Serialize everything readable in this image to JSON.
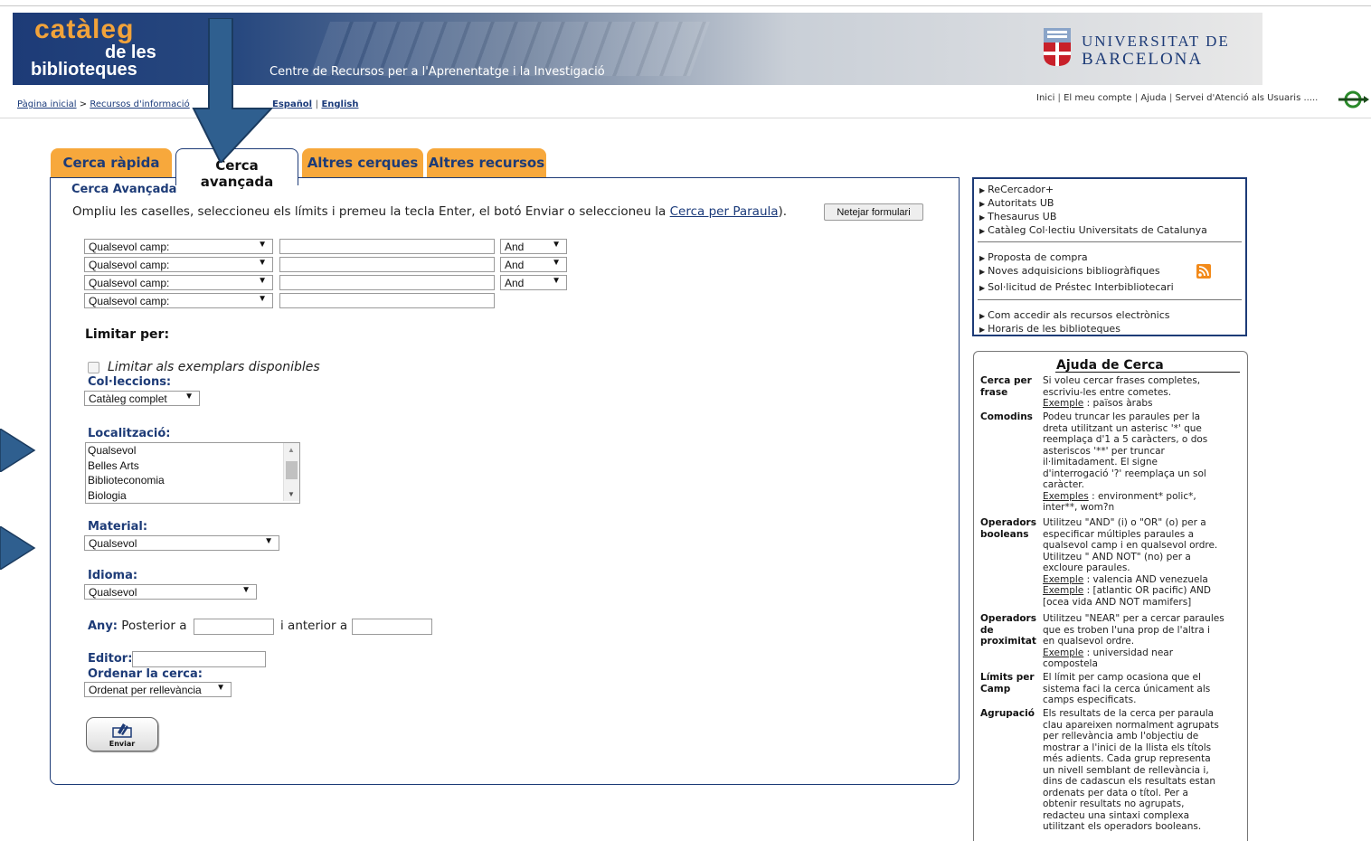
{
  "header": {
    "logo_line1": "catàleg",
    "logo_line2": "de les",
    "logo_line3": "biblioteques",
    "center_title": "Centre de Recursos per a l'Aprenentatge i la Investigació",
    "university_line1": "UNIVERSITAT DE",
    "university_line2": "BARCELONA"
  },
  "breadcrumb": {
    "home": "Pàgina inicial",
    "sep": ">",
    "section": "Recursos d'informació"
  },
  "languages": {
    "es": "Español",
    "sep": "|",
    "en": "English"
  },
  "toplinks": {
    "inici": "Inici",
    "account": "El meu compte",
    "help": "Ajuda",
    "service": "Servei d'Atenció als Usuaris",
    "sep": "|",
    "dots": "....."
  },
  "tabs": {
    "quick": "Cerca ràpida",
    "advanced_l1": "Cerca",
    "advanced_l2": "avançada",
    "other": "Altres cerques",
    "resources": "Altres recursos"
  },
  "form": {
    "title": "Cerca Avançada",
    "instructions_pre": "Ompliu les caselles, seleccioneu els límits i premeu la tecla Enter, el botó Enviar o seleccioneu la ",
    "instructions_link": "Cerca per Paraula",
    "instructions_post": ").",
    "reset_label": "Netejar formulari",
    "field_select": "Qualsevol camp:",
    "bool_select": "And",
    "limit_heading": "Limitar per:",
    "available_label": "Limitar als exemplars disponibles",
    "collections_label": "Col·leccions:",
    "collections_value": "Catàleg complet",
    "location_label": "Localització:",
    "location_options": [
      "Qualsevol",
      "Belles Arts",
      "Biblioteconomia",
      "Biologia"
    ],
    "material_label": "Material:",
    "material_value": "Qualsevol",
    "language_label": "Idioma:",
    "language_value": "Qualsevol",
    "year_label": "Any:",
    "year_after": "Posterior a",
    "year_before": "i anterior a",
    "publisher_label": "Editor:",
    "sort_label": "Ordenar la cerca:",
    "sort_value": "Ordenat per rellevància",
    "submit_label": "Enviar"
  },
  "side_links": {
    "group1": [
      "ReCercador+",
      "Autoritats UB",
      "Thesaurus UB",
      "Catàleg Col·lectiu Universitats de Catalunya"
    ],
    "group2": [
      "Proposta de compra",
      "Noves adquisicions bibliogràfiques",
      "Sol·licitud de Préstec Interbibliotecari"
    ],
    "group3": [
      "Com accedir als recursos electrònics",
      "Horaris de les biblioteques"
    ]
  },
  "help": {
    "title": "Ajuda de Cerca",
    "phrase_term_1": "Cerca per",
    "phrase_term_2": "frase",
    "phrase_desc": [
      "Si voleu cercar frases completes,",
      "escriviu-les entre cometes."
    ],
    "phrase_ex_label": "Exemple",
    "phrase_ex": " : països àrabs",
    "wild_term": "Comodins",
    "wild_desc": [
      "Podeu truncar les paraules per la",
      "dreta utilitzant un asterisc '*' que",
      "reemplaça d'1 a 5 caràcters, o dos",
      "asteriscos '**' per truncar",
      "il·limitadament. El signe",
      "d'interrogació '?' reemplaça un sol",
      "caràcter."
    ],
    "wild_ex_label": "Exemples",
    "wild_ex": " : environment* polic*,",
    "wild_ex2": "inter**, wom?n",
    "bool_term_1": "Operadors",
    "bool_term_2": "booleans",
    "bool_desc": [
      "Utilitzeu \"AND\" (i) o \"OR\" (o) per a",
      "especificar múltiples paraules a",
      "qualsevol camp i en qualsevol ordre.",
      "Utilitzeu \" AND NOT\" (no) per a",
      "excloure paraules."
    ],
    "bool_ex_label": "Exemple",
    "bool_ex1": " : valencia AND venezuela",
    "bool_ex2": " : [atlantic OR pacific) AND",
    "bool_ex3": "[ocea vida AND NOT mamifers]",
    "prox_term_1": "Operadors",
    "prox_term_2": "de",
    "prox_term_3": "proximitat",
    "prox_desc": [
      "Utilitzeu \"NEAR\" per a cercar paraules",
      "que es troben l'una prop de l'altra i",
      "en qualsevol ordre."
    ],
    "prox_ex_label": "Exemple",
    "prox_ex": " : universidad near",
    "prox_ex2": "compostela",
    "limits_term_1": "Límits per",
    "limits_term_2": "Camp",
    "limits_desc": [
      "El límit per camp ocasiona que el",
      "sistema faci la cerca únicament als",
      "camps especificats."
    ],
    "group_term": "Agrupació",
    "group_desc": [
      "Els resultats de la cerca per paraula",
      "clau apareixen normalment agrupats",
      "per rellevància amb l'objectiu de",
      "mostrar a l'inici de la llista els títols",
      "més adients. Cada grup representa",
      "un nivell semblant de rellevància i,",
      "dins de cadascun els resultats estan",
      "ordenats per data o títol. Per a",
      "obtenir resultats no agrupats,",
      "redacteu una sintaxi complexa",
      "utilitzant els operadors booleans."
    ]
  },
  "colors": {
    "brand_blue": "#1d3b77",
    "tab_orange": "#f7a83c",
    "logo_orange": "#f2a33a",
    "annotation_arrow": "#2f5f8f"
  }
}
